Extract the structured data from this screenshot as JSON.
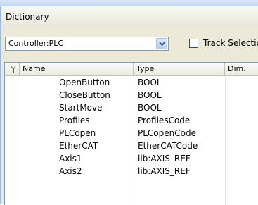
{
  "panel": {
    "title": "Dictionary"
  },
  "toolbar": {
    "controller_value": "Controller:PLC",
    "track_label": "Track Selection",
    "track_checked": false
  },
  "table": {
    "headers": {
      "icon": "filter-icon",
      "name": "Name",
      "type": "Type",
      "dim": "Dim."
    },
    "rows": [
      {
        "name": "OpenButton",
        "type": "BOOL"
      },
      {
        "name": "CloseButton",
        "type": "BOOL"
      },
      {
        "name": "StartMove",
        "type": "BOOL"
      },
      {
        "name": "Profiles",
        "type": "ProfilesCode"
      },
      {
        "name": "PLCopen",
        "type": "PLCopenCode"
      },
      {
        "name": "EtherCAT",
        "type": "EtherCATCode"
      },
      {
        "name": "Axis1",
        "type": "lib:AXIS_REF"
      },
      {
        "name": "Axis2",
        "type": "lib:AXIS_REF"
      }
    ]
  }
}
